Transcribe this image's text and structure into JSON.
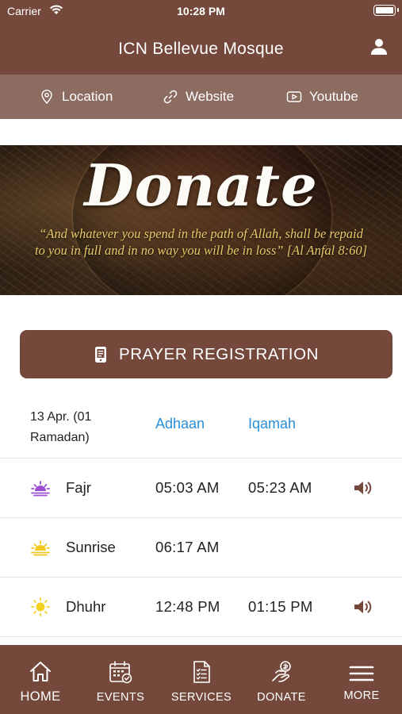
{
  "status_bar": {
    "carrier": "Carrier",
    "time": "10:28 PM"
  },
  "header": {
    "title": "ICN Bellevue Mosque"
  },
  "links": [
    {
      "label": "Location",
      "icon": "location-pin-icon"
    },
    {
      "label": "Website",
      "icon": "link-icon"
    },
    {
      "label": "Youtube",
      "icon": "youtube-icon"
    }
  ],
  "banner": {
    "headline": "Donate",
    "quote_line1": "“And whatever you spend in the path of Allah, shall be repaid",
    "quote_line2": "to you in full and in no way you will be in loss” [Al Anfal 8:60]"
  },
  "registration": {
    "label": "PRAYER REGISTRATION",
    "icon": "document-phone-icon"
  },
  "prayer_table": {
    "date_line1": "13 Apr. (01",
    "date_line2": "Ramadan)",
    "col_adhaan": "Adhaan",
    "col_iqamah": "Iqamah",
    "rows": [
      {
        "name": "Fajr",
        "adhaan": "05:03 AM",
        "iqamah": "05:23 AM",
        "icon": "sunrise-purple-icon",
        "icon_color": "#9b4fd1",
        "speaker": true
      },
      {
        "name": "Sunrise",
        "adhaan": "06:17 AM",
        "iqamah": "",
        "icon": "sunrise-yellow-icon",
        "icon_color": "#f2c81e",
        "speaker": false
      },
      {
        "name": "Dhuhr",
        "adhaan": "12:48 PM",
        "iqamah": "01:15 PM",
        "icon": "sun-icon",
        "icon_color": "#f2d21e",
        "speaker": true
      }
    ]
  },
  "tabs": [
    {
      "label": "HOME",
      "icon": "home-icon",
      "active": true
    },
    {
      "label": "EVENTS",
      "icon": "calendar-icon",
      "active": false
    },
    {
      "label": "SERVICES",
      "icon": "checklist-icon",
      "active": false
    },
    {
      "label": "DONATE",
      "icon": "donate-hand-icon",
      "active": false
    },
    {
      "label": "MORE",
      "icon": "menu-icon",
      "active": false
    }
  ],
  "colors": {
    "primary": "#74493c",
    "linkbar": "#8c6b61",
    "accent_blue": "#2a8fd6",
    "speaker": "#74493c"
  }
}
